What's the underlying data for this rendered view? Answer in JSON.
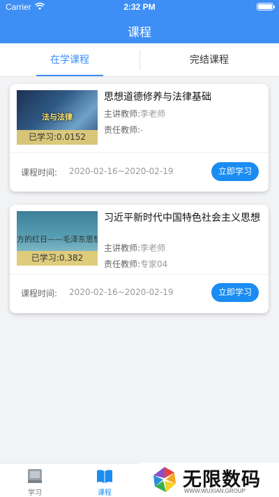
{
  "status_bar": {
    "carrier": "Carrier",
    "time": "2:32 PM"
  },
  "header": {
    "title": "课程"
  },
  "tabs": [
    {
      "label": "在学课程",
      "active": true
    },
    {
      "label": "完结课程",
      "active": false
    }
  ],
  "courses": [
    {
      "thumb_caption": "法与法律",
      "progress": "已学习:0.0152",
      "title": "思想道德修养与法律基础",
      "lecturer_label": "主讲教师:",
      "lecturer": "李老师",
      "responsible_label": "责任教师:",
      "responsible": "-",
      "time_label": "课程时间:",
      "time": "2020-02-16~2020-02-19",
      "button": "立即学习"
    },
    {
      "thumb_caption": "方的红日——毛泽东思想",
      "progress": "已学习:0.382",
      "title": "习近平新时代中国特色社会主义思想",
      "lecturer_label": "主讲教师:",
      "lecturer": "李老师",
      "responsible_label": "责任教师:",
      "responsible": "专家04",
      "time_label": "课程时间:",
      "time": "2020-02-16~2020-02-19",
      "button": "立即学习"
    }
  ],
  "tabbar": [
    {
      "label": "学习",
      "icon": "book-icon",
      "active": false
    },
    {
      "label": "课程",
      "icon": "open-book-icon",
      "active": true
    }
  ],
  "watermark": {
    "text": "无限数码",
    "sub": "WWW.WUXIAN.GROUP"
  },
  "colors": {
    "primary": "#3d8ef5",
    "button": "#1a8cf2",
    "progress_bg": "#e4cc76"
  }
}
